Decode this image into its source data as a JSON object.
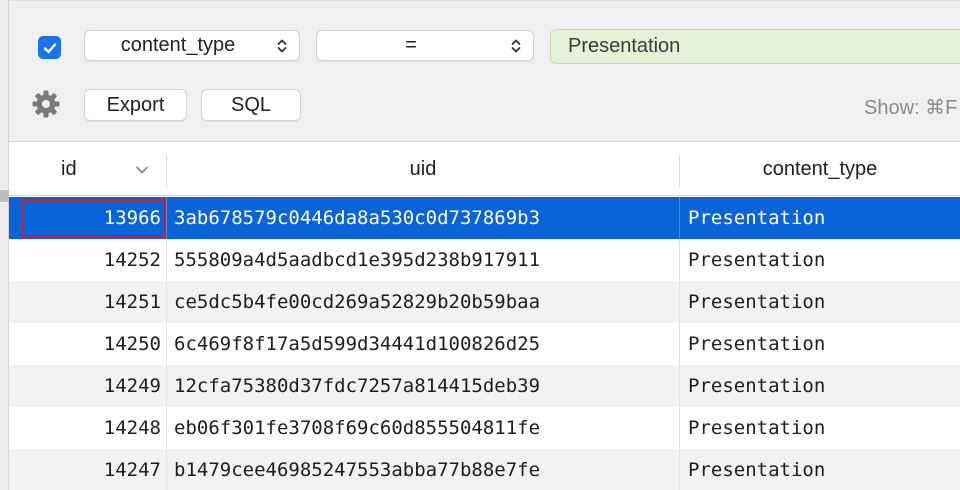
{
  "filter": {
    "enabled": true,
    "field": "content_type",
    "operator": "=",
    "value": "Presentation"
  },
  "toolbar": {
    "export_label": "Export",
    "sql_label": "SQL",
    "show_label": "Show: ⌘F"
  },
  "table": {
    "columns": [
      "id",
      "uid",
      "content_type"
    ],
    "rows": [
      {
        "id": "13966",
        "uid": "3ab678579c0446da8a530c0d737869b3",
        "content_type": "Presentation"
      },
      {
        "id": "14252",
        "uid": "555809a4d5aadbcd1e395d238b917911",
        "content_type": "Presentation"
      },
      {
        "id": "14251",
        "uid": "ce5dc5b4fe00cd269a52829b20b59baa",
        "content_type": "Presentation"
      },
      {
        "id": "14250",
        "uid": "6c469f8f17a5d599d34441d100826d25",
        "content_type": "Presentation"
      },
      {
        "id": "14249",
        "uid": "12cfa75380d37fdc7257a814415deb39",
        "content_type": "Presentation"
      },
      {
        "id": "14248",
        "uid": "eb06f301fe3708f69c60d855504811fe",
        "content_type": "Presentation"
      },
      {
        "id": "14247",
        "uid": "b1479cee46985247553abba77b88e7fe",
        "content_type": "Presentation"
      }
    ],
    "selected_row_index": 0
  },
  "colors": {
    "accent": "#0a64d8",
    "filter_value_bg": "#e4f1d6",
    "focus_ring": "#c0223e"
  }
}
